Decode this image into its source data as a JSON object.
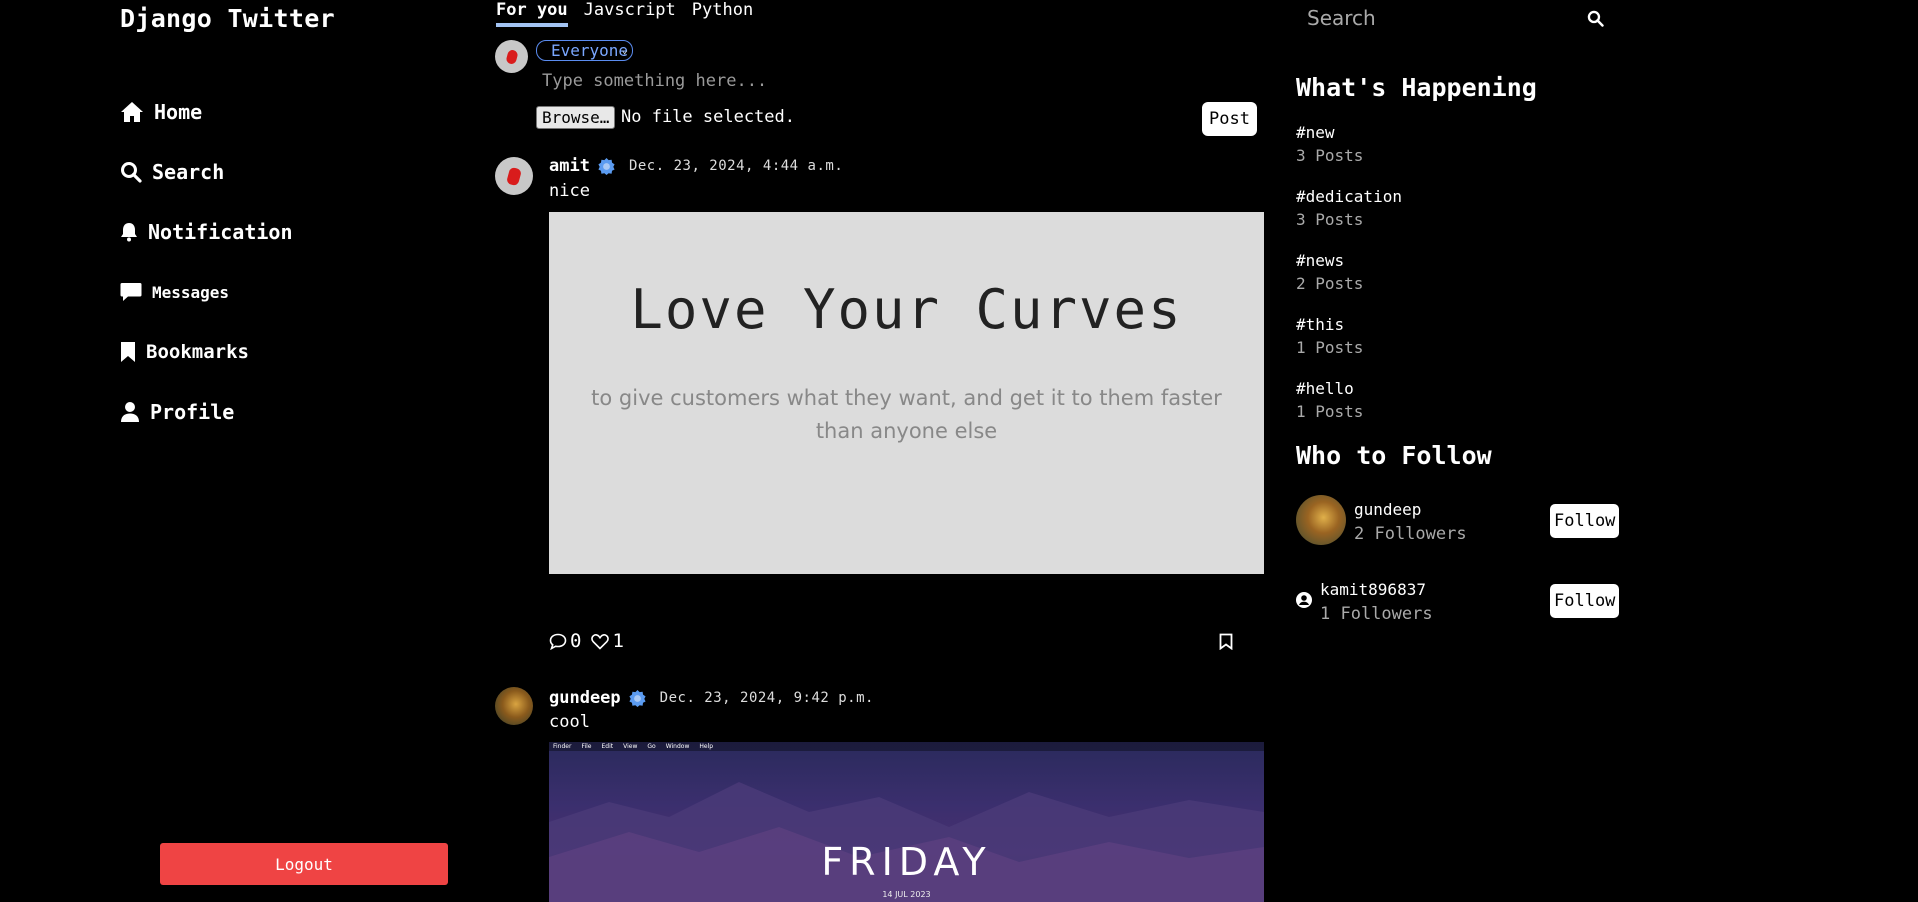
{
  "brand": "Django Twitter",
  "nav": [
    {
      "label": "Home",
      "icon": "home-icon"
    },
    {
      "label": "Search",
      "icon": "search-icon"
    },
    {
      "label": "Notification",
      "icon": "bell-icon"
    },
    {
      "label": "Messages",
      "icon": "message-icon"
    },
    {
      "label": "Bookmarks",
      "icon": "bookmark-icon"
    },
    {
      "label": "Profile",
      "icon": "user-icon"
    }
  ],
  "logout_label": "Logout",
  "tabs": [
    "For you",
    "Javscript",
    "Python"
  ],
  "compose": {
    "audience": "Everyone",
    "placeholder": "Type something here...",
    "browse_label": "Browse…",
    "no_file": "No file selected.",
    "post_label": "Post"
  },
  "posts": [
    {
      "user": "amit",
      "timestamp": "Dec. 23, 2024, 4:44 a.m.",
      "text": "nice",
      "image_headline": "Love Your Curves",
      "image_subtext": "to give customers what they want, and get it to them faster than anyone else",
      "comments": "0",
      "likes": "1"
    },
    {
      "user": "gundeep",
      "timestamp": "Dec. 23, 2024, 9:42 p.m.",
      "text": "cool",
      "image_headline": "FRIDAY",
      "image_date": "14 JUL 2023",
      "image_menu": [
        "Finder",
        "File",
        "Edit",
        "View",
        "Go",
        "Window",
        "Help"
      ]
    }
  ],
  "search_placeholder": "Search",
  "whats_happening": {
    "title": "What's Happening",
    "trends": [
      {
        "tag": "#new",
        "count": "3 Posts"
      },
      {
        "tag": "#dedication",
        "count": "3 Posts"
      },
      {
        "tag": "#news",
        "count": "2 Posts"
      },
      {
        "tag": "#this",
        "count": "1 Posts"
      },
      {
        "tag": "#hello",
        "count": "1 Posts"
      }
    ]
  },
  "who_to_follow": {
    "title": "Who to Follow",
    "users": [
      {
        "name": "gundeep",
        "followers": "2 Followers",
        "button": "Follow"
      },
      {
        "name": "kamit896837",
        "followers": "1 Followers",
        "button": "Follow"
      }
    ]
  },
  "colors": {
    "accent": "#a3c4f3",
    "logout": "#ef4444",
    "verified": "#5b9bf0"
  }
}
